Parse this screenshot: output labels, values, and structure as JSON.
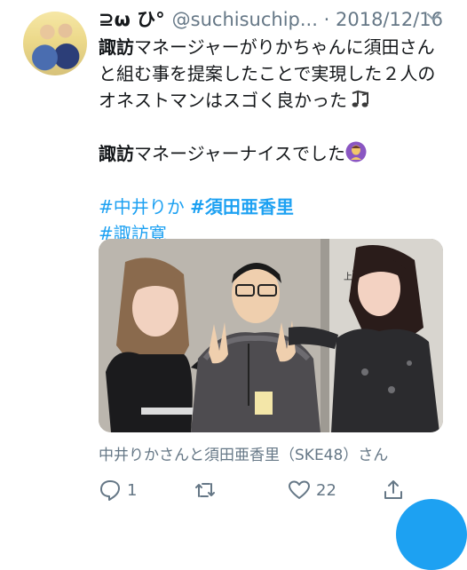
{
  "tweet": {
    "display_name": "⊇ω ひ°",
    "handle": "@suchisuchip...",
    "separator": "·",
    "date": "2018/12/16",
    "lines": {
      "l1_a": "諏訪",
      "l1_b": "マネージャーがりかちゃんに須田さん",
      "l2": "と組む事を提案したことで実現した２人の",
      "l3": "オネストマンはスゴく良かった",
      "l4_a": "諏訪",
      "l4_b": "マネージャーナイスでした"
    },
    "hashtags": [
      "#中井りか",
      "#須田亜香里",
      "#諏訪寛"
    ],
    "caption": "中井りかさんと須田亜香里（SKE48）さん",
    "sign_text": "上手3"
  },
  "actions": {
    "reply_count": "1",
    "retweet_count": "",
    "like_count": "22"
  },
  "colors": {
    "accent": "#1da1f2",
    "secondary_text": "#657786",
    "primary_text": "#14171a"
  },
  "icons": [
    "avatar",
    "chevron-down-icon",
    "music-notes-icon",
    "person-bowing-icon",
    "reply-icon",
    "retweet-icon",
    "like-icon",
    "share-icon"
  ]
}
